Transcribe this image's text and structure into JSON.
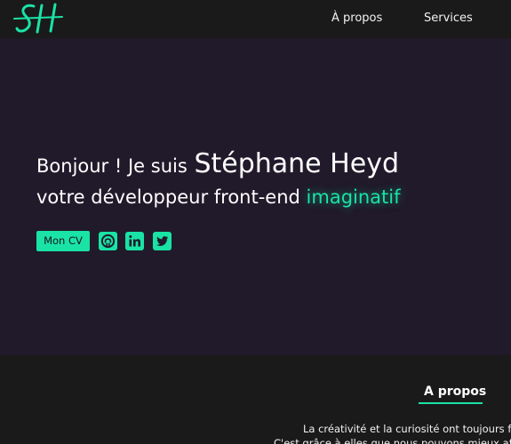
{
  "header": {
    "logo_text": "SH",
    "nav": [
      {
        "label": "À propos"
      },
      {
        "label": "Services"
      }
    ]
  },
  "hero": {
    "greeting": "Bonjour ! Je suis",
    "name": "Stéphane Heyd",
    "subtitle": "votre développeur front-end",
    "accent_word": "imaginatif",
    "cv_button": "Mon CV",
    "social_icons": [
      "github-icon",
      "linkedin-icon",
      "twitter-icon"
    ]
  },
  "about": {
    "title": "A propos",
    "text_line1": "La créativité et la curiosité ont toujours fai",
    "text_line2": "C'est grâce à elles que nous pouvons mieux affr"
  },
  "colors": {
    "accent": "#19e3a5",
    "hero_bg": "#211a2b",
    "header_bg": "#1a1a1a"
  }
}
